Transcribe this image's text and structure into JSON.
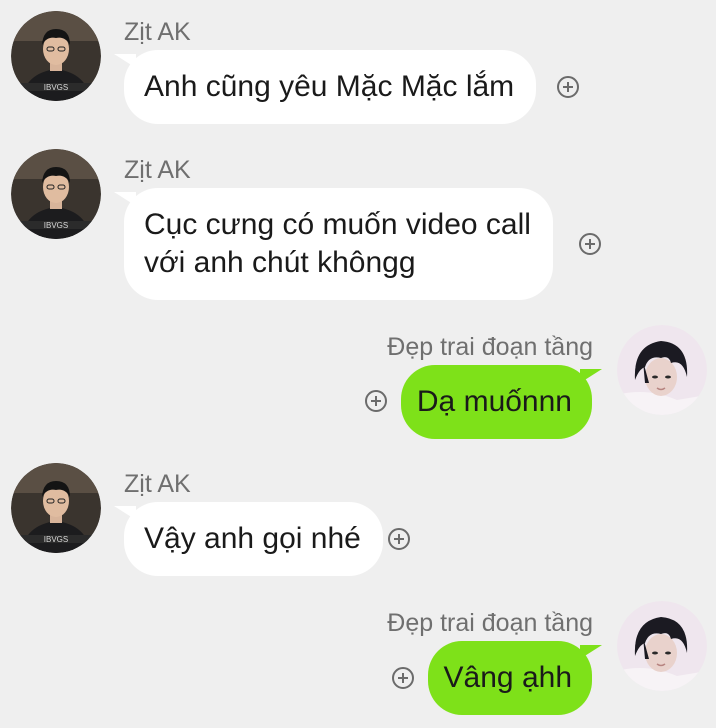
{
  "conversation": {
    "messages": [
      {
        "sender": "Zịt AK",
        "direction": "incoming",
        "lines": [
          "Anh cũng yêu Mặc Mặc lắm"
        ]
      },
      {
        "sender": "Zịt AK",
        "direction": "incoming",
        "lines": [
          "Cục cưng có muốn video call",
          "với anh chút khôngg"
        ]
      },
      {
        "sender": "Đẹp trai đoạn tầng",
        "direction": "outgoing",
        "lines": [
          "Dạ muốnnn"
        ]
      },
      {
        "sender": "Zịt AK",
        "direction": "incoming",
        "lines": [
          "Vậy anh gọi nhé"
        ]
      },
      {
        "sender": "Đẹp trai đoạn tầng",
        "direction": "outgoing",
        "lines": [
          "Vâng ạhh"
        ]
      }
    ]
  },
  "icons": {
    "reaction": "add-reaction-icon",
    "incoming_avatar": "avatar-man-black-jacket",
    "outgoing_avatar": "avatar-person-dark-hair"
  },
  "colors": {
    "background": "#efefef",
    "incoming_bubble": "#ffffff",
    "outgoing_bubble": "#7ee119",
    "sender_name": "#6f6f6f",
    "message_text": "#1a1a1a"
  }
}
